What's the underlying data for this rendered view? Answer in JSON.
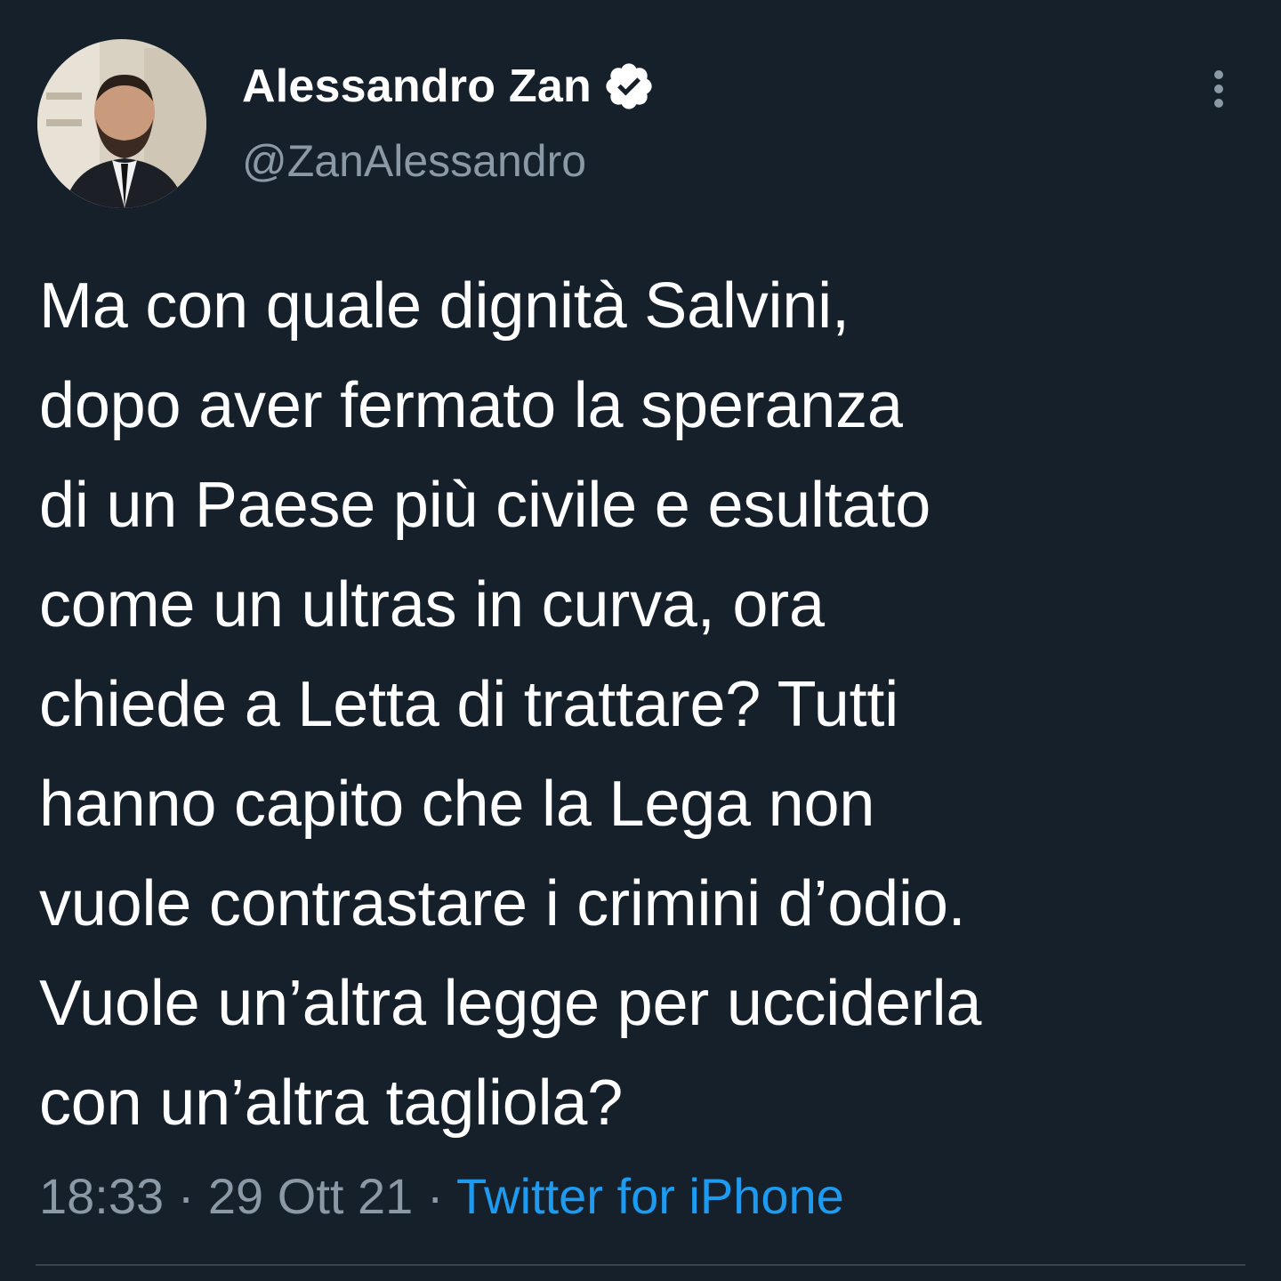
{
  "author": {
    "display_name": "Alessandro Zan",
    "handle": "@ZanAlessandro",
    "verified_icon": "verified-badge-icon",
    "avatar": "profile-photo"
  },
  "tweet": {
    "text": "Ma con quale dignità Salvini,\ndopo aver fermato la speranza\ndi un Paese più civile e esultato\ncome un ultras in curva, ora\nchiede a Letta di trattare? Tutti\nhanno capito che la Lega non\nvuole contrastare i crimini d’odio.\nVuole un’altra legge per ucciderla\ncon un’altra tagliola?",
    "time": "18:33",
    "separator": " · ",
    "date": "29 Ott 21",
    "source": "Twitter for iPhone"
  },
  "icons": {
    "more": "more-options-icon"
  },
  "colors": {
    "background": "#15202b",
    "text": "#ffffff",
    "secondary_text": "#8b98a5",
    "link": "#1d9bf0",
    "divider": "#38444d"
  }
}
